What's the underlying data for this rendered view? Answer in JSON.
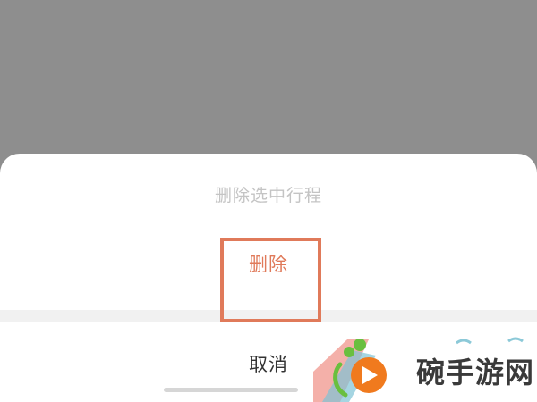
{
  "action_sheet": {
    "title": "删除选中行程",
    "delete_label": "删除",
    "cancel_label": "取消"
  },
  "watermark": {
    "text": "碗手游网"
  },
  "colors": {
    "overlay": "#8e8e8e",
    "sheet_background": "#ffffff",
    "delete_text": "#e07a5a",
    "highlight_box": "#e07a5a",
    "cancel_text": "#333333",
    "title_text": "#c4c4c4"
  }
}
